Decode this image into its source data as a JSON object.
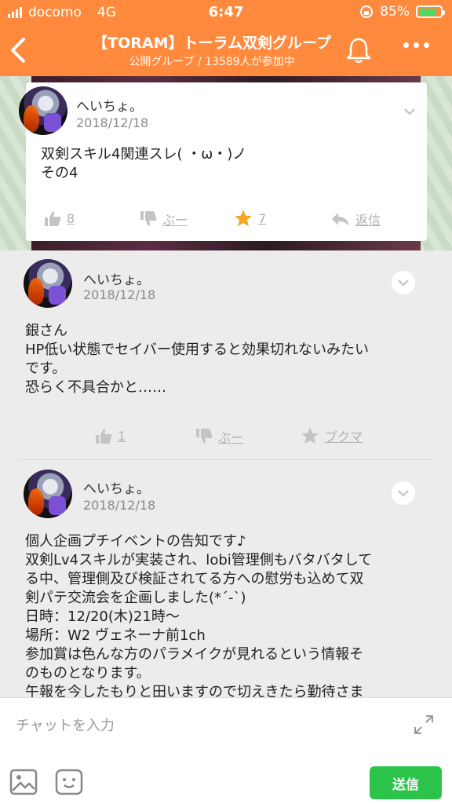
{
  "status_bar": {
    "carrier": "docomo",
    "network": "4G",
    "time": "6:47",
    "battery": "85%"
  },
  "header": {
    "title": "【TORAM】トーラム双剣グループ",
    "subtitle": "公開グループ / 13589人が参加中"
  },
  "pinned_post": {
    "author": "へいちょ。",
    "date": "2018/12/18",
    "body_lines": [
      "双剣スキル4関連スレ( ・ω・)ノ",
      "その4"
    ],
    "like_count": "8",
    "boo_label": "ぶー",
    "star_count": "7",
    "reply_label": "返信"
  },
  "posts": [
    {
      "author": "へいちょ。",
      "date": "2018/12/18",
      "body_lines": [
        "銀さん",
        "HP低い状態でセイバー使用すると効果切れないみたい",
        "です。",
        "恐らく不具合かと……"
      ],
      "like_count": "1",
      "boo_label": "ぶー",
      "bookmark_label": "ブクマ"
    },
    {
      "author": "へいちょ。",
      "date": "2018/12/18",
      "body_lines": [
        "個人企画プチイベントの告知です♪",
        "双剣Lv4スキルが実装され、lobi管理側もバタバタして",
        "る中、管理側及び検証されてる方への慰労も込めて双",
        "剣パテ交流会を企画しました(*´-`)",
        "日時：12/20(木)21時〜",
        "場所：W2 ヴェネーナ前1ch",
        "参加賞は色んな方のパラメイクが見れるという情報そ",
        "のものとなります。",
        "午報を今したもりと田いますので切えきたら勤待さま"
      ]
    }
  ],
  "chat": {
    "placeholder": "チャットを入力",
    "send_label": "送信"
  },
  "colors": {
    "header": "#ff8a3d",
    "send": "#2cc34a",
    "star": "#f5a623"
  }
}
